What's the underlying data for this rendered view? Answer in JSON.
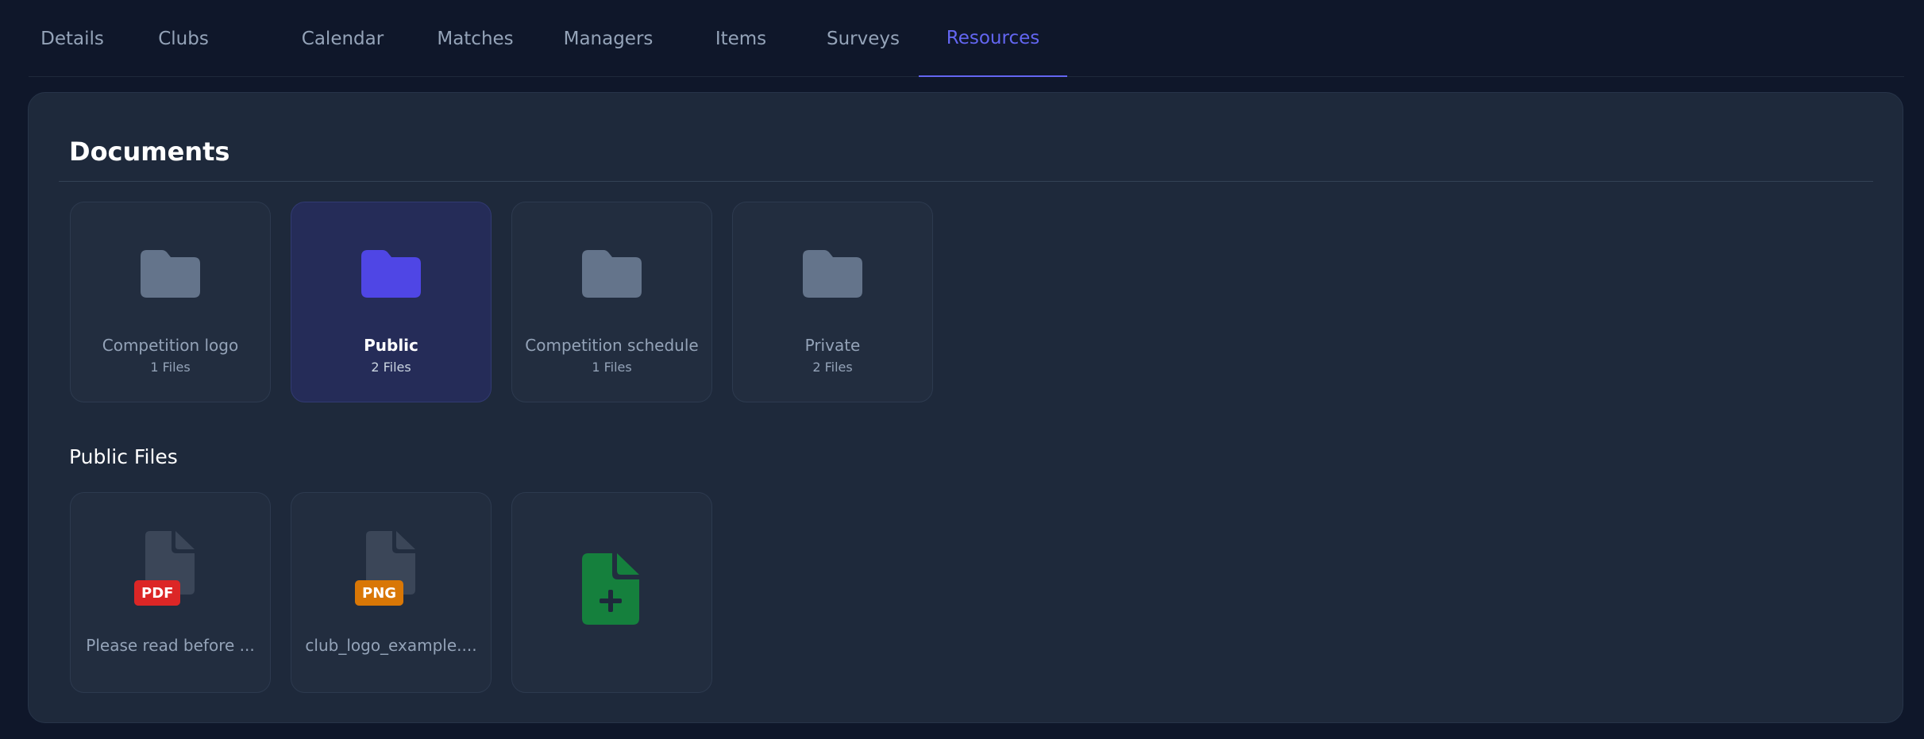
{
  "tabs": [
    {
      "label": "Details"
    },
    {
      "label": "Clubs"
    },
    {
      "label": "Calendar"
    },
    {
      "label": "Matches"
    },
    {
      "label": "Managers"
    },
    {
      "label": "Items"
    },
    {
      "label": "Surveys"
    },
    {
      "label": "Resources",
      "active": true
    }
  ],
  "documents": {
    "title": "Documents",
    "folders": [
      {
        "name": "Competition logo",
        "count": "1 Files",
        "icon": "folder-icon"
      },
      {
        "name": "Public",
        "count": "2 Files",
        "icon": "folder-icon",
        "selected": true
      },
      {
        "name": "Competition schedule",
        "count": "1 Files",
        "icon": "folder-icon"
      },
      {
        "name": "Private",
        "count": "2 Files",
        "icon": "folder-icon"
      }
    ]
  },
  "files_section": {
    "title": "Public Files",
    "files": [
      {
        "name": "Please read before ...",
        "type": "PDF",
        "badge_color": "#dc2626",
        "icon": "file-icon"
      },
      {
        "name": "club_logo_example....",
        "type": "PNG",
        "badge_color": "#d97706",
        "icon": "file-icon"
      }
    ],
    "add_icon": "file-plus-icon"
  },
  "colors": {
    "accent": "#6366f1",
    "folder_default": "#64748b",
    "folder_selected": "#4f46e5",
    "add_file": "#15803d"
  }
}
